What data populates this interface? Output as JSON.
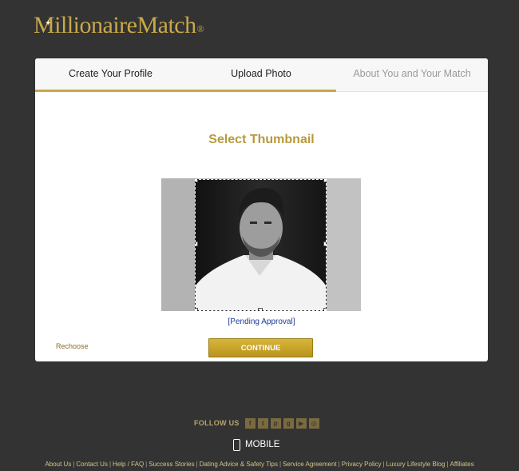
{
  "brand": {
    "name": "MillionaireMatch",
    "registered_mark": "®"
  },
  "tabs": [
    {
      "label": "Create Your Profile",
      "state": "completed"
    },
    {
      "label": "Upload Photo",
      "state": "active"
    },
    {
      "label": "About You and Your Match",
      "state": "upcoming"
    }
  ],
  "main": {
    "title": "Select Thumbnail",
    "status": "[Pending Approval]",
    "rechoose_label": "Rechoose",
    "continue_label": "CONTINUE"
  },
  "follow": {
    "label": "FOLLOW US",
    "icons": [
      "facebook-icon",
      "twitter-icon",
      "pinterest-icon",
      "google-plus-icon",
      "youtube-icon",
      "instagram-icon"
    ]
  },
  "mobile": {
    "label": "MOBILE"
  },
  "footer": {
    "links": [
      "About Us",
      "Contact Us",
      "Help / FAQ",
      "Success Stories",
      "Dating Advice & Safety Tips",
      "Service Agreement",
      "Privacy Policy",
      "Luxury Lifestyle Blog",
      "Affiliates"
    ]
  },
  "colors": {
    "gold": "#c9a84a",
    "background": "#333333",
    "link_blue": "#1a3a9c"
  }
}
